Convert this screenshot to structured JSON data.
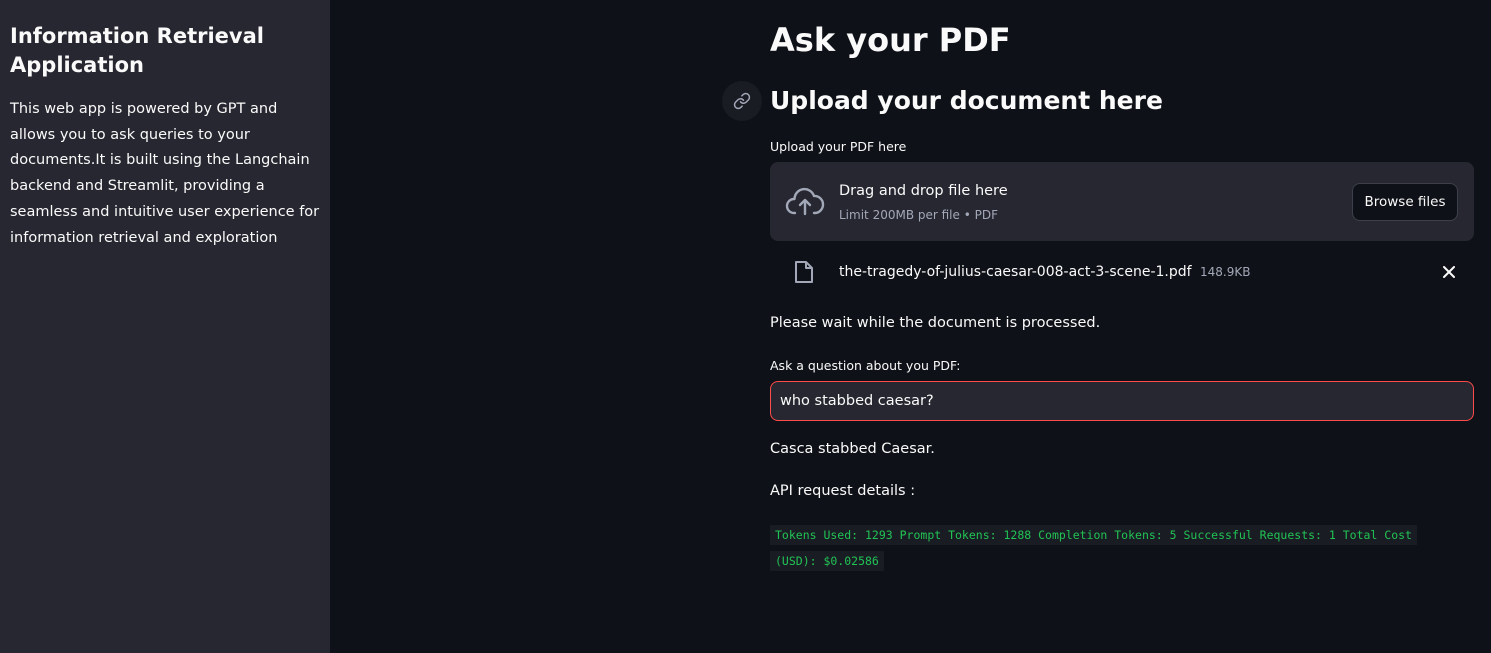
{
  "sidebar": {
    "title": "Information Retrieval Application",
    "description": "This web app is powered by GPT and allows you to ask queries to your documents.It is built using the Langchain backend and Streamlit, providing a seamless and intuitive user experience for information retrieval and exploration"
  },
  "main": {
    "title": "Ask your PDF",
    "section_title": "Upload your document here",
    "anchor_icon": "link-icon"
  },
  "uploader": {
    "label": "Upload your PDF here",
    "drop_title": "Drag and drop file here",
    "limit": "Limit 200MB per file • PDF",
    "browse_label": "Browse files",
    "icon": "cloud-upload-icon"
  },
  "uploaded_file": {
    "name": "the-tragedy-of-julius-caesar-008-act-3-scene-1.pdf",
    "size": "148.9KB",
    "icon": "file-icon"
  },
  "status": {
    "message": "Please wait while the document is processed."
  },
  "question": {
    "label": "Ask a question about you PDF:",
    "value": "who stabbed caesar?"
  },
  "answer": {
    "text": "Casca stabbed Caesar."
  },
  "api": {
    "label": "API request details :",
    "details": "Tokens Used: 1293 Prompt Tokens: 1288 Completion Tokens: 5 Successful Requests: 1 Total Cost (USD): $0.02586"
  },
  "colors": {
    "background": "#0e1117",
    "sidebar": "#262730",
    "accent": "#ff4b4b",
    "code_green": "#21c354"
  }
}
